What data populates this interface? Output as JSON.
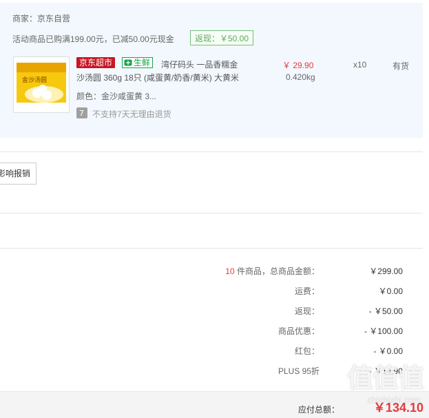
{
  "merchant": {
    "label": "商家：京东自营"
  },
  "promo": {
    "text": "活动商品已购满199.00元，已减50.00元现金",
    "badge": "返现：￥50.00"
  },
  "product": {
    "tag_jd": "京东超市",
    "tag_fresh": "生鲜",
    "title_line1": "湾仔码头 一品香糯金",
    "title_line2": "沙汤圆 360g 18只 (咸蛋黄/奶香/黄米) 大黄米",
    "price": "￥ 29.90",
    "weight": "0.420kg",
    "qty": "x10",
    "stock": "有货",
    "color": "颜色：金沙咸蛋黄 3...",
    "return_policy": "不支持7天无理由退货",
    "return_icon_glyph": "7",
    "image_text": "金沙汤圆"
  },
  "invoice_button": {
    "label": "影响报销"
  },
  "summary": {
    "item_count": "10",
    "item_total_label": "件商品，总商品金额：",
    "item_total_value": "￥299.00",
    "shipping_label": "运费：",
    "shipping_value": "￥0.00",
    "rebate_label": "返现：",
    "rebate_value": "- ￥50.00",
    "discount_label": "商品优惠：",
    "discount_value": "- ￥100.00",
    "redpacket_label": "红包：",
    "redpacket_value": "- ￥0.00",
    "plus_label": "PLUS 95折",
    "plus_value": "- ￥14.90",
    "total_label": "应付总额：",
    "total_value": "￥134.10"
  },
  "watermark": {
    "text": "值值值",
    "url": "zhizhizhi.com"
  },
  "colors": {
    "accent_red": "#e4393c",
    "jd_red": "#c81623",
    "fresh_green": "#16a34a",
    "panel_bg": "#f3f8fe"
  }
}
